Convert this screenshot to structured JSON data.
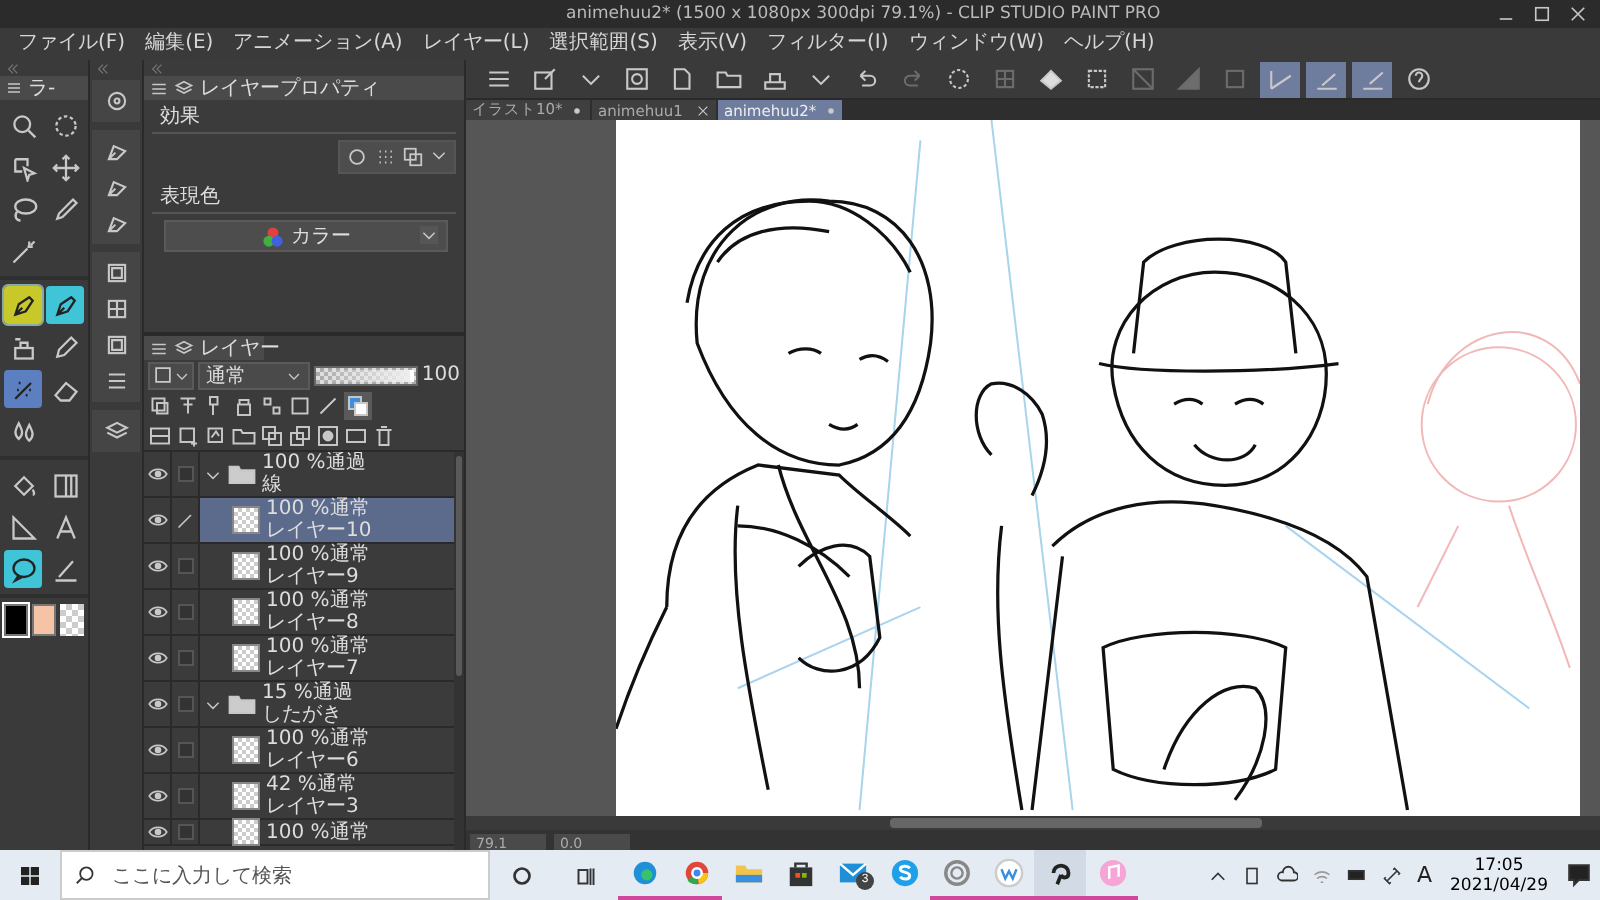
{
  "window": {
    "title": "animehuu2* (1500 x 1080px 300dpi 79.1%) - CLIP STUDIO PAINT PRO"
  },
  "menu": [
    "ファイル(F)",
    "編集(E)",
    "アニメーション(A)",
    "レイヤー(L)",
    "選択範囲(S)",
    "表示(V)",
    "フィルター(I)",
    "ウィンドウ(W)",
    "ヘルプ(H)"
  ],
  "toolbar_buttons": [
    {
      "on": false,
      "disabled": false
    },
    {
      "on": false,
      "disabled": false
    },
    {
      "on": false,
      "disabled": false
    },
    {
      "on": false,
      "disabled": false
    },
    {
      "on": false,
      "disabled": false
    },
    {
      "on": false,
      "disabled": false
    },
    {
      "on": false,
      "disabled": false
    },
    {
      "on": false,
      "disabled": false
    },
    {
      "on": false,
      "disabled": false
    },
    {
      "on": false,
      "disabled": true
    },
    {
      "on": false,
      "disabled": false
    },
    {
      "on": false,
      "disabled": true
    },
    {
      "on": false,
      "disabled": false
    },
    {
      "on": false,
      "disabled": false
    },
    {
      "on": false,
      "disabled": true
    },
    {
      "on": false,
      "disabled": true
    },
    {
      "on": false,
      "disabled": true
    },
    {
      "on": true,
      "disabled": false
    },
    {
      "on": true,
      "disabled": false
    },
    {
      "on": true,
      "disabled": false
    },
    {
      "on": false,
      "disabled": false
    }
  ],
  "tool_palette": {
    "tab": "ラ-",
    "groups": [
      {
        "tools": [
          {
            "selected": false
          },
          {
            "selected": false
          },
          {
            "selected": false
          },
          {
            "selected": false
          },
          {
            "selected": false
          },
          {
            "selected": false
          },
          {
            "selected": false
          }
        ]
      },
      {
        "tools": [
          {
            "selected": true
          },
          {
            "selected": false
          },
          {
            "selected": false
          },
          {
            "selected": false
          },
          {
            "selected": false
          },
          {
            "selected": false
          },
          {
            "selected": false
          }
        ]
      },
      {
        "tools": [
          {
            "selected": false
          },
          {
            "selected": false
          },
          {
            "selected": false
          },
          {
            "selected": false
          },
          {
            "selected": false
          },
          {
            "selected": false
          }
        ]
      }
    ]
  },
  "colors": [
    {
      "color": "#000000",
      "selected": true
    },
    {
      "color": "#f5c3a5",
      "selected": false
    }
  ],
  "properties": {
    "tab": "レイヤープロパティ",
    "effect_label": "効果",
    "color_label": "表現色",
    "color_mode": "カラー"
  },
  "layers": {
    "tab": "レイヤー",
    "blend_mode": "通常",
    "opacity_slider": {
      "level": 1.0
    },
    "opacity": "100",
    "items": [
      {
        "kind": "folder",
        "opacity_mode": "100 %通過",
        "name": "線",
        "expanded": true,
        "visible": true,
        "selected": false,
        "children": [
          {
            "kind": "layer",
            "opacity_mode": "100 %通常",
            "name": "レイヤー10",
            "visible": true,
            "selected": true
          },
          {
            "kind": "layer",
            "opacity_mode": "100 %通常",
            "name": "レイヤー9",
            "visible": true,
            "selected": false
          },
          {
            "kind": "layer",
            "opacity_mode": "100 %通常",
            "name": "レイヤー8",
            "visible": true,
            "selected": false
          },
          {
            "kind": "layer",
            "opacity_mode": "100 %通常",
            "name": "レイヤー7",
            "visible": true,
            "selected": false
          }
        ]
      },
      {
        "kind": "folder",
        "opacity_mode": "15 %通過",
        "name": "したがき",
        "expanded": true,
        "visible": true,
        "selected": false,
        "children": [
          {
            "kind": "layer",
            "opacity_mode": "100 %通常",
            "name": "レイヤー6",
            "visible": true,
            "selected": false
          },
          {
            "kind": "layer",
            "opacity_mode": "42 %通常",
            "name": "レイヤー3",
            "visible": true,
            "selected": false
          },
          {
            "kind": "layer",
            "opacity_mode": "100 %通常",
            "visible": true,
            "selected": false
          }
        ]
      }
    ]
  },
  "tabs": [
    {
      "label": "イラスト10*",
      "modified": true,
      "selected": false
    },
    {
      "label": "animehuu1",
      "modified": false,
      "selected": false
    },
    {
      "label": "animehuu2*",
      "modified": true,
      "selected": true
    }
  ],
  "status_bar": {
    "zoom": "79.1",
    "angle": "0.0"
  },
  "taskbar": {
    "search_placeholder": "ここに入力して検索",
    "apps": [
      {
        "running": true,
        "selected": false
      },
      {
        "running": true,
        "selected": false
      },
      {
        "running": false,
        "selected": false
      },
      {
        "running": false,
        "selected": false
      },
      {
        "running": false,
        "selected": false
      },
      {
        "running": false,
        "selected": false
      },
      {
        "running": true,
        "selected": false
      },
      {
        "running": true,
        "selected": false
      },
      {
        "running": true,
        "selected": true
      },
      {
        "running": true,
        "selected": false
      }
    ],
    "mail_badge": "3",
    "ime": "A",
    "time": "17:05",
    "date": "2021/04/29"
  }
}
